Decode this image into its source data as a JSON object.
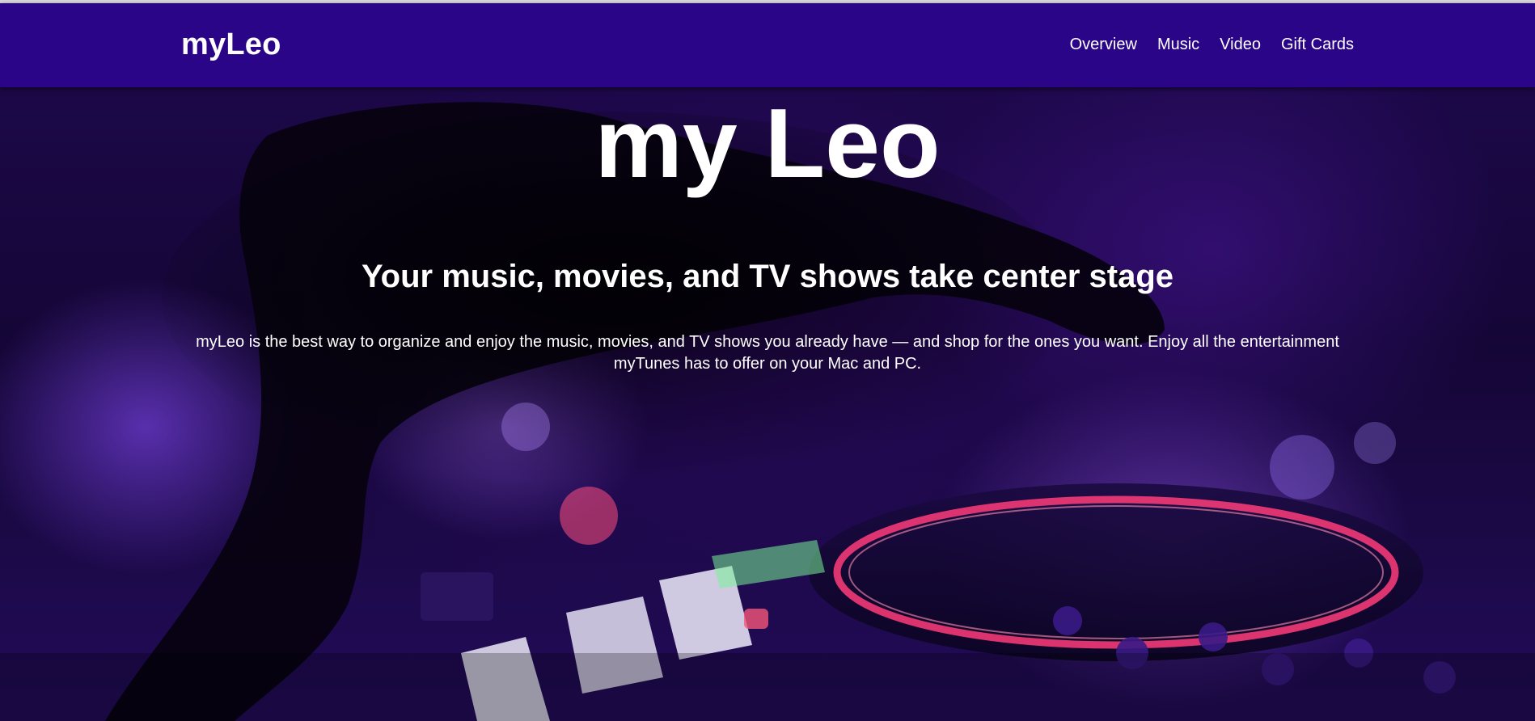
{
  "header": {
    "brand": "myLeo",
    "nav": [
      {
        "label": "Overview"
      },
      {
        "label": "Music"
      },
      {
        "label": "Video"
      },
      {
        "label": "Gift Cards"
      }
    ]
  },
  "hero": {
    "title": "my Leo",
    "subtitle": "Your music, movies, and TV shows take center stage",
    "description": "myLeo is the best way to organize and enjoy the music, movies, and TV shows you already have — and shop for the ones you want. Enjoy all the entertainment myTunes has to offer on your Mac and PC."
  },
  "colors": {
    "navbar": "#2a0587",
    "text": "#ffffff"
  }
}
